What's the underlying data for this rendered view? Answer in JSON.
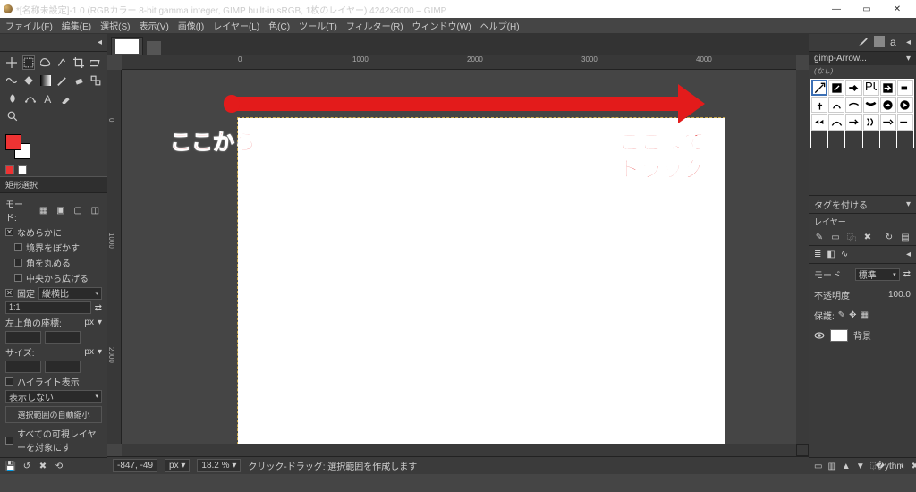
{
  "title": "*[名称未設定]-1.0 (RGBカラー 8-bit gamma integer, GIMP built-in sRGB, 1枚のレイヤー) 4242x3000 – GIMP",
  "menu": [
    "ファイル(F)",
    "編集(E)",
    "選択(S)",
    "表示(V)",
    "画像(I)",
    "レイヤー(L)",
    "色(C)",
    "ツール(T)",
    "フィルター(R)",
    "ウィンドウ(W)",
    "ヘルプ(H)"
  ],
  "tool_options": {
    "title": "矩形選択",
    "mode_label": "モード:",
    "smooth": "なめらかに",
    "blur_edge": "境界をぼかす",
    "round_corner": "角を丸める",
    "expand_center": "中央から広げる",
    "fixed": "固定",
    "fixed_mode": "縦横比",
    "ratio": "1:1",
    "pos_label": "左上角の座標:",
    "pos_unit": "px",
    "size_label": "サイズ:",
    "size_unit": "px",
    "highlight": "ハイライト表示",
    "noshow_label": "表示しない",
    "autoshrink": "選択範囲の自動縮小",
    "all_layers": "すべての可視レイヤーを対象にす"
  },
  "status": {
    "coords": "-847, -49",
    "unit": "px",
    "zoom": "18.2 %",
    "hint": "クリック-ドラッグ: 選択範囲を作成します"
  },
  "ruler_ticks": [
    "0",
    "1000",
    "2000",
    "3000",
    "4000"
  ],
  "ruler_ticks_v": [
    "0",
    "1000",
    "2000"
  ],
  "right": {
    "brush_name": "gimp-Arrow...",
    "brush_sub": "(なし)",
    "tag_label": "タグを付ける",
    "layers_title": "レイヤー",
    "mode_label": "モード",
    "mode_value": "標準",
    "opacity_label": "不透明度",
    "opacity_value": "100.0",
    "lock_label": "保護:",
    "layer_name": "背景"
  },
  "annot": {
    "from": "ここから",
    "to1": "ここまで",
    "to2": "ドラッグ"
  }
}
